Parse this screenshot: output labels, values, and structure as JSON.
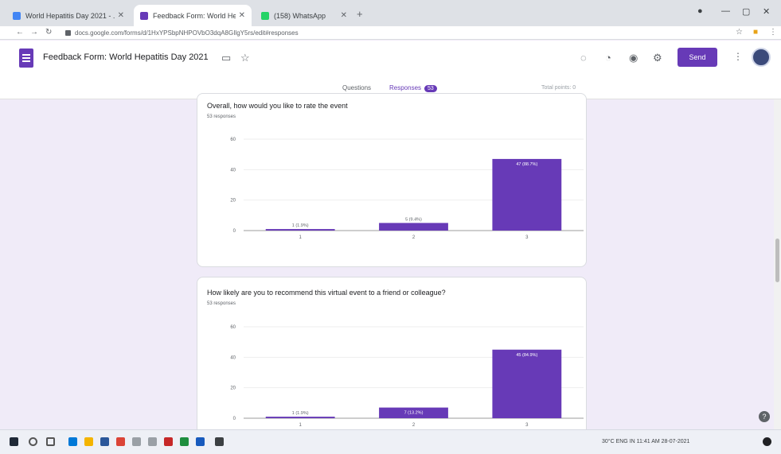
{
  "browser": {
    "tabs": [
      {
        "title": "World Hepatitis Day 2021 - ...",
        "favicon_color": "#4285f4"
      },
      {
        "title": "Feedback Form: World Hepatit...",
        "favicon_color": "#673ab7"
      },
      {
        "title": "(158) WhatsApp",
        "favicon_color": "#25d366"
      }
    ],
    "new_tab": "+",
    "url": "docs.google.com/forms/d/1HxYPSbpNHPOVbO3dqA8GIlgY5rs/edit#responses"
  },
  "form": {
    "title": "Feedback Form: World Hepatitis Day 2021",
    "send_label": "Send",
    "tabs": [
      {
        "label": "Questions"
      },
      {
        "label": "Responses",
        "count": "53"
      }
    ],
    "saved_text": "Total points: 0"
  },
  "cards": [
    {
      "question": "Overall, how would you like to rate the event",
      "responses": "53 responses",
      "chart_data": {
        "type": "bar",
        "categories": [
          "1",
          "2",
          "3"
        ],
        "values": [
          1,
          5,
          47
        ],
        "data_labels": [
          "1 (1.9%)",
          "5 (9.4%)",
          "47 (88.7%)"
        ],
        "ylim": [
          0,
          60
        ],
        "yticks": [
          0,
          20,
          40,
          60
        ],
        "bar_color": "#673ab7"
      }
    },
    {
      "question": "How likely are you to recommend this virtual event to a friend or colleague?",
      "responses": "53 responses",
      "chart_data": {
        "type": "bar",
        "categories": [
          "1",
          "2",
          "3"
        ],
        "values": [
          1,
          7,
          45
        ],
        "data_labels": [
          "1 (1.9%)",
          "7 (13.2%)",
          "45 (84.9%)"
        ],
        "ylim": [
          0,
          60
        ],
        "yticks": [
          0,
          20,
          40,
          60
        ],
        "bar_color": "#673ab7"
      }
    }
  ],
  "taskbar": {
    "tray_text": "30°C  ENG IN  11:41 AM  28-07-2021"
  },
  "help": "?"
}
